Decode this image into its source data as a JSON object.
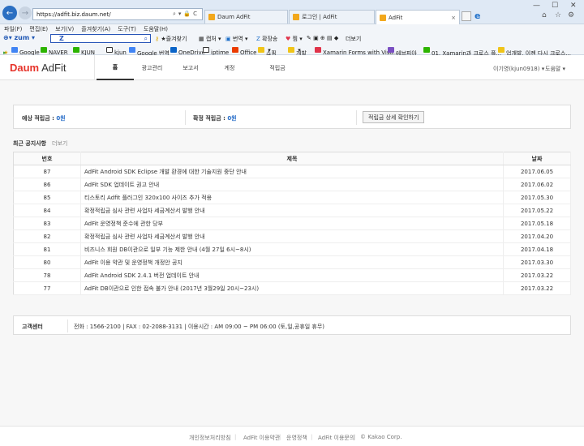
{
  "browser": {
    "url": "https://adfit.biz.daum.net/",
    "tabs": [
      {
        "label": "Daum AdFit",
        "color": "#f2a81d"
      },
      {
        "label": "로그인 | AdFit",
        "color": "#f2a81d"
      },
      {
        "label": "AdFit",
        "color": "#f2a81d"
      }
    ],
    "menu": [
      "파일(F)",
      "편집(E)",
      "보기(V)",
      "즐겨찾기(A)",
      "도구(T)",
      "도움말(H)"
    ],
    "zum_label": "zum",
    "toolbar_items": [
      "즐겨찾기",
      "캡처",
      "번역",
      "확장송",
      "찜",
      "더보기"
    ],
    "favorites": [
      "Google",
      "NAVER",
      "KJUN",
      "kjun",
      "Google 번역",
      "OneDrive",
      "iptime",
      "Office",
      "쇼핑",
      "개발",
      "Xamarin Forms with Visu...",
      "에브피아",
      "01. Xamarin과 크로스 플...",
      "업개발, 이젠 다시 크로스..."
    ]
  },
  "site": {
    "logo_daum": "Daum",
    "logo_adfit": "AdFit",
    "nav": [
      "홈",
      "광고관리",
      "보고서",
      "계정",
      "적립금"
    ],
    "user": "이기영(kjun0918) ▾",
    "help": "도움말 ▾"
  },
  "summary": {
    "expected_label": "예상 적립금 : ",
    "expected_value": "0원",
    "confirmed_label": "확정 적립금 : ",
    "confirmed_value": "0원",
    "detail_button": "적립금 상세 확인하기"
  },
  "notices": {
    "title": "최근 공지사항",
    "more": "더보기",
    "headers": [
      "번호",
      "제목",
      "날짜"
    ],
    "rows": [
      {
        "no": "87",
        "title": "AdFit Android SDK Eclipse 개발 환경에 대한 기술지원 중단 안내",
        "date": "2017.06.05"
      },
      {
        "no": "86",
        "title": "AdFit SDK 업데이트 권고 안내",
        "date": "2017.06.02"
      },
      {
        "no": "85",
        "title": "티스토리 Adfit 플러그인 320x100 사이즈 추가 적용",
        "date": "2017.05.30"
      },
      {
        "no": "84",
        "title": "확정적립금 심사 관련 사업자 세금계산서 발행 안내",
        "date": "2017.05.22"
      },
      {
        "no": "83",
        "title": "AdFit 운영정책 준수에 관한 당부",
        "date": "2017.05.18"
      },
      {
        "no": "82",
        "title": "확정적립금 심사 관련 사업자 세금계산서 발행 안내",
        "date": "2017.04.20"
      },
      {
        "no": "81",
        "title": "비즈니스 회원 DB이관으로 일부 기능 제한 안내 (4월 27일 6시~8시)",
        "date": "2017.04.18"
      },
      {
        "no": "80",
        "title": "AdFit 이용 약관 및 운영정책 개정안 공지",
        "date": "2017.03.30"
      },
      {
        "no": "78",
        "title": "AdFit Android SDK 2.4.1 버전 업데이트 안내",
        "date": "2017.03.22"
      },
      {
        "no": "77",
        "title": "AdFit DB이관으로 인한 접속 불가 안내 (2017년 3월29일 20시~23시)",
        "date": "2017.03.22"
      }
    ]
  },
  "customer_center": {
    "label": "고객센터",
    "info": "전화 : 1566-2100  |  FAX : 02-2088-3131  |  이용시간 : AM 09:00 ~ PM 06:00 (토,일,공휴일 휴무)"
  },
  "footer": [
    "개인정보처리방침",
    "AdFit 이용약관",
    "운영정책",
    "AdFit 이용문의",
    "© Kakao Corp."
  ]
}
